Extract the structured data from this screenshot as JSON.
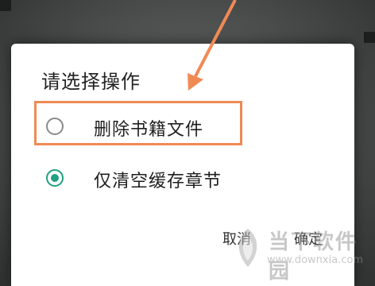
{
  "dialog": {
    "title": "请选择操作",
    "options": [
      {
        "label": "删除书籍文件",
        "selected": false
      },
      {
        "label": "仅清空缓存章节",
        "selected": true
      }
    ],
    "buttons": {
      "cancel": "取消",
      "ok": "确定"
    }
  },
  "annotation": {
    "color": "#f08a55",
    "icon": "arrow-pointer-icon"
  },
  "watermark": {
    "logo": "downxia-logo",
    "cn": "当下软件园",
    "en": "www.downxia.com"
  },
  "colors": {
    "accent": "#20a084",
    "highlight": "#f08a55",
    "radio_off": "#8a8a8a"
  }
}
